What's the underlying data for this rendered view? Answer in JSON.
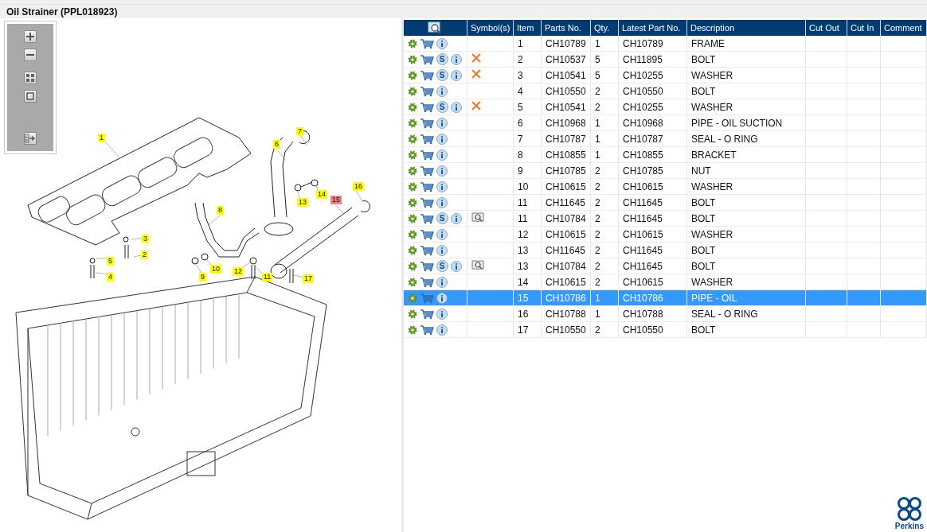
{
  "title": "Oil Strainer (PPL018923)",
  "toolbar": [
    {
      "kind": "zoom-in"
    },
    {
      "kind": "zoom-out"
    },
    {
      "kind": "fit"
    },
    {
      "kind": "frame"
    },
    {
      "kind": "export"
    }
  ],
  "callouts": [
    {
      "label": "1",
      "selected": false
    },
    {
      "label": "2",
      "selected": false
    },
    {
      "label": "3",
      "selected": false
    },
    {
      "label": "4",
      "selected": false
    },
    {
      "label": "5",
      "selected": false
    },
    {
      "label": "6",
      "selected": false
    },
    {
      "label": "7",
      "selected": false
    },
    {
      "label": "8",
      "selected": false
    },
    {
      "label": "9",
      "selected": false
    },
    {
      "label": "10",
      "selected": false
    },
    {
      "label": "11",
      "selected": false
    },
    {
      "label": "12",
      "selected": false
    },
    {
      "label": "13",
      "selected": false
    },
    {
      "label": "14",
      "selected": false
    },
    {
      "label": "15",
      "selected": true
    },
    {
      "label": "16",
      "selected": false
    },
    {
      "label": "17",
      "selected": false
    }
  ],
  "table": {
    "columns": [
      "Symbol(s)",
      "Item",
      "Parts No.",
      "Qty.",
      "Latest Part No.",
      "Description",
      "Cut Out",
      "Cut In",
      "Comment"
    ],
    "rows": [
      {
        "item": "1",
        "parts_no": "CH10789",
        "qty": "1",
        "latest": "CH10789",
        "description": "FRAME",
        "kind": "plain",
        "selected": false
      },
      {
        "item": "2",
        "parts_no": "CH10537",
        "qty": "5",
        "latest": "CH11895",
        "description": "BOLT",
        "badge": "S",
        "kind": "cross",
        "selected": false
      },
      {
        "item": "3",
        "parts_no": "CH10541",
        "qty": "5",
        "latest": "CH10255",
        "description": "WASHER",
        "badge": "S",
        "kind": "cross",
        "selected": false
      },
      {
        "item": "4",
        "parts_no": "CH10550",
        "qty": "2",
        "latest": "CH10550",
        "description": "BOLT",
        "kind": "plain",
        "selected": false
      },
      {
        "item": "5",
        "parts_no": "CH10541",
        "qty": "2",
        "latest": "CH10255",
        "description": "WASHER",
        "badge": "S",
        "kind": "cross",
        "selected": false
      },
      {
        "item": "6",
        "parts_no": "CH10968",
        "qty": "1",
        "latest": "CH10968",
        "description": "PIPE - OIL SUCTION",
        "kind": "plain",
        "selected": false
      },
      {
        "item": "7",
        "parts_no": "CH10787",
        "qty": "1",
        "latest": "CH10787",
        "description": "SEAL - O RING",
        "kind": "plain",
        "selected": false
      },
      {
        "item": "8",
        "parts_no": "CH10855",
        "qty": "1",
        "latest": "CH10855",
        "description": "BRACKET",
        "kind": "plain",
        "selected": false
      },
      {
        "item": "9",
        "parts_no": "CH10785",
        "qty": "2",
        "latest": "CH10785",
        "description": "NUT",
        "kind": "plain",
        "selected": false
      },
      {
        "item": "10",
        "parts_no": "CH10615",
        "qty": "2",
        "latest": "CH10615",
        "description": "WASHER",
        "kind": "plain",
        "selected": false
      },
      {
        "item": "11",
        "parts_no": "CH11645",
        "qty": "2",
        "latest": "CH11645",
        "description": "BOLT",
        "kind": "plain",
        "selected": false
      },
      {
        "item": "11",
        "parts_no": "CH10784",
        "qty": "2",
        "latest": "CH11645",
        "description": "BOLT",
        "badge": "S",
        "kind": "book",
        "selected": false
      },
      {
        "item": "12",
        "parts_no": "CH10615",
        "qty": "2",
        "latest": "CH10615",
        "description": "WASHER",
        "kind": "plain",
        "selected": false
      },
      {
        "item": "13",
        "parts_no": "CH11645",
        "qty": "2",
        "latest": "CH11645",
        "description": "BOLT",
        "kind": "plain",
        "selected": false
      },
      {
        "item": "13",
        "parts_no": "CH10784",
        "qty": "2",
        "latest": "CH11645",
        "description": "BOLT",
        "badge": "S",
        "kind": "book",
        "selected": false
      },
      {
        "item": "14",
        "parts_no": "CH10615",
        "qty": "2",
        "latest": "CH10615",
        "description": "WASHER",
        "kind": "plain",
        "selected": false
      },
      {
        "item": "15",
        "parts_no": "CH10786",
        "qty": "1",
        "latest": "CH10786",
        "description": "PIPE - OIL",
        "kind": "plain",
        "selected": true
      },
      {
        "item": "16",
        "parts_no": "CH10788",
        "qty": "1",
        "latest": "CH10788",
        "description": "SEAL - O RING",
        "kind": "plain",
        "selected": false
      },
      {
        "item": "17",
        "parts_no": "CH10550",
        "qty": "2",
        "latest": "CH10550",
        "description": "BOLT",
        "kind": "plain",
        "selected": false
      }
    ]
  },
  "brand": "Perkins"
}
